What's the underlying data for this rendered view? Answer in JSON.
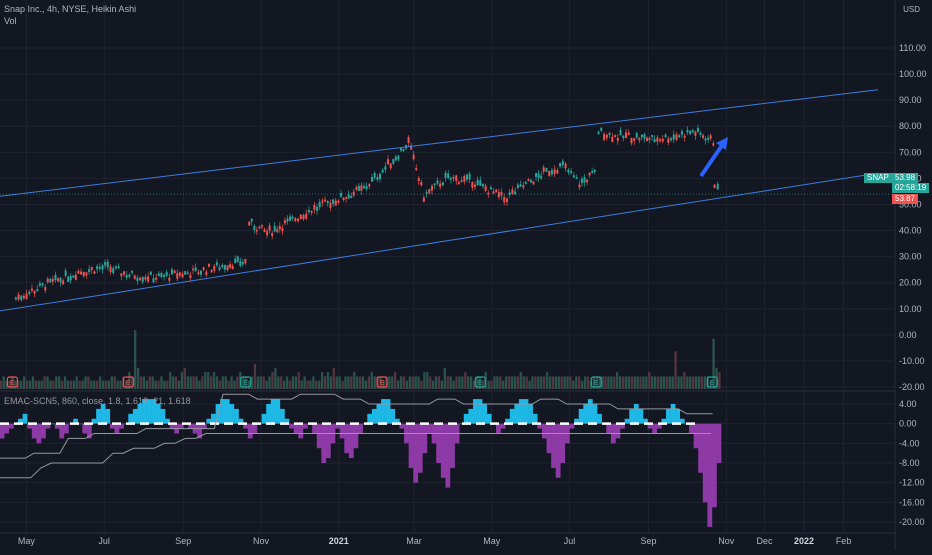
{
  "header": {
    "title": "Snap Inc., 4h, NYSE, Heikin Ashi",
    "volume_label": "Vol"
  },
  "currency": "USD",
  "ticker_badge": {
    "symbol": "SNAP",
    "last_price": "53.98",
    "countdown": "02:58:19",
    "low_price": "53.87"
  },
  "indicator_label": "EMAC-SCN5, 860, close, 1.8, 1.618, 21, 1.618",
  "colors": {
    "background": "#131722",
    "up": "#26a69a",
    "down": "#ef5350",
    "channel": "#2962ff",
    "hist_pos": "#1eb8e6",
    "hist_neg": "#8e3aa6",
    "event_red": "#ef5350",
    "event_green": "#26a69a"
  },
  "chart_data": [
    {
      "type": "line",
      "title": "Snap Inc., 4h, NYSE, Heikin Ashi",
      "x_ticks": [
        "May",
        "Jul",
        "Sep",
        "Nov",
        "2021",
        "Mar",
        "May",
        "Jul",
        "Sep",
        "Nov",
        "Dec",
        "2022",
        "Feb"
      ],
      "y_ticks": [
        "110.00",
        "100.00",
        "90.00",
        "80.00",
        "70.00",
        "60.00",
        "50.00",
        "40.00",
        "30.00",
        "20.00",
        "10.00",
        "0.00",
        "-10.00",
        "-20.00"
      ],
      "ylim": [
        -20,
        115
      ],
      "series": [
        {
          "name": "SNAP",
          "x": [
            "2020-04-22",
            "2020-05-15",
            "2020-06-10",
            "2020-07-01",
            "2020-07-20",
            "2020-08-10",
            "2020-09-10",
            "2020-10-05",
            "2020-10-19",
            "2020-10-22",
            "2020-11-05",
            "2020-11-25",
            "2020-12-10",
            "2020-12-31",
            "2021-01-20",
            "2021-02-10",
            "2021-02-24",
            "2021-03-08",
            "2021-03-25",
            "2021-04-15",
            "2021-05-10",
            "2021-05-25",
            "2021-06-10",
            "2021-06-25",
            "2021-07-08",
            "2021-07-20",
            "2021-07-23",
            "2021-08-05",
            "2021-08-20",
            "2021-09-05",
            "2021-09-20",
            "2021-10-05",
            "2021-10-15",
            "2021-10-21",
            "2021-10-22",
            "2021-10-27"
          ],
          "y": [
            14,
            19,
            24,
            26,
            23,
            22,
            24,
            27,
            28,
            43,
            39,
            44,
            48,
            52,
            56,
            66,
            74,
            53,
            60,
            59,
            52,
            57,
            62,
            65,
            58,
            62,
            78,
            76,
            76,
            75,
            76,
            78,
            76,
            74,
            58,
            53
          ],
          "color": "#ef5350"
        }
      ],
      "channel_lines": [
        {
          "name": "upper",
          "from": [
            "2020-04-08",
            53
          ],
          "to": [
            "2022-02-28",
            94
          ]
        },
        {
          "name": "lower",
          "from": [
            "2020-04-08",
            9
          ],
          "to": [
            "2022-02-28",
            62
          ]
        }
      ],
      "volume": {
        "values": [
          2,
          3,
          2,
          2,
          3,
          2,
          2,
          2,
          3,
          2,
          2,
          3,
          2,
          2,
          2,
          3,
          3,
          2,
          2,
          3,
          3,
          2,
          3,
          2,
          2,
          2,
          3,
          2,
          2,
          3,
          3,
          2,
          2,
          2,
          3,
          2,
          2,
          2,
          3,
          3,
          2,
          2,
          3,
          2,
          4,
          3,
          14,
          5,
          3,
          3,
          2,
          3,
          3,
          2,
          2,
          3,
          2,
          2,
          4,
          3,
          3,
          2,
          4,
          5,
          3,
          3,
          3,
          3,
          2,
          3,
          4,
          4,
          3,
          4,
          3,
          2,
          3,
          3,
          2,
          3,
          2,
          3,
          4,
          3,
          3,
          2,
          3,
          6,
          3,
          3,
          3,
          2,
          3,
          4,
          5,
          3,
          3,
          2,
          3,
          2,
          3,
          3,
          4,
          2,
          3,
          2,
          2,
          3,
          2,
          2,
          4,
          3,
          4,
          3,
          5,
          3,
          3,
          2,
          3,
          3,
          3,
          4,
          3,
          3,
          3,
          2,
          3,
          4,
          3,
          3,
          3,
          2,
          3,
          3,
          3,
          4,
          2,
          3,
          3,
          2,
          3,
          3,
          3,
          3,
          2,
          4,
          4,
          3,
          2,
          3,
          3,
          2,
          5,
          3,
          3,
          2,
          3,
          3,
          3,
          4,
          3,
          3,
          2,
          3,
          3,
          2,
          4,
          2,
          2,
          3,
          3,
          3,
          2,
          3,
          3,
          3,
          3,
          3,
          4,
          3,
          3,
          2,
          3,
          3,
          3,
          3,
          3,
          4,
          3,
          3,
          3,
          3,
          3,
          3,
          3,
          3,
          2,
          3,
          3,
          2,
          3,
          3,
          2,
          3,
          3,
          3,
          3,
          3,
          3,
          3,
          3,
          4,
          3,
          3,
          3,
          3,
          3,
          3,
          3,
          3,
          3,
          3,
          4,
          3,
          3,
          3,
          3,
          3,
          3,
          3,
          3,
          9,
          3,
          3,
          4,
          3,
          3,
          3,
          3,
          3,
          3,
          3,
          3,
          2,
          12,
          5,
          4
        ],
        "events": [
          {
            "x": "2020-04-20",
            "label": "E",
            "color": "#ef5350"
          },
          {
            "x": "2020-07-20",
            "label": "E",
            "color": "#ef5350"
          },
          {
            "x": "2020-10-20",
            "label": "E",
            "color": "#26a69a"
          },
          {
            "x": "2021-02-04",
            "label": "E",
            "color": "#ef5350"
          },
          {
            "x": "2021-04-22",
            "label": "E",
            "color": "#26a69a"
          },
          {
            "x": "2021-07-22",
            "label": "E",
            "color": "#26a69a"
          },
          {
            "x": "2021-10-21",
            "label": "E",
            "color": "#26a69a"
          }
        ]
      }
    },
    {
      "type": "area",
      "title": "EMAC-SCN5, 860, close, 1.8, 1.618, 21, 1.618",
      "y_ticks": [
        "4.00",
        "0.00",
        "-4.00",
        "-8.00",
        "-12.00",
        "-16.00",
        "-20.00"
      ],
      "ylim": [
        -22,
        6
      ],
      "series": [
        {
          "name": "oscillator",
          "values": [
            -3,
            -2,
            -1,
            0,
            1,
            2,
            -1,
            -3,
            -4,
            -3,
            -1,
            0,
            -1,
            -3,
            -2,
            0,
            1,
            0,
            -2,
            -3,
            1,
            3,
            4,
            3,
            -1,
            -2,
            -1,
            0,
            2,
            3,
            4,
            5,
            5,
            5,
            4,
            3,
            1,
            -1,
            -2,
            -1,
            0,
            -1,
            -2,
            -3,
            -1,
            1,
            2,
            4,
            5,
            5,
            4,
            3,
            1,
            -1,
            -3,
            -2,
            0,
            2,
            4,
            5,
            5,
            3,
            1,
            -1,
            -2,
            -3,
            -1,
            0,
            -2,
            -5,
            -8,
            -7,
            -4,
            -1,
            -3,
            -6,
            -7,
            -5,
            -2,
            0,
            2,
            3,
            4,
            5,
            5,
            3,
            1,
            -1,
            -4,
            -9,
            -12,
            -10,
            -6,
            -2,
            -4,
            -8,
            -11,
            -13,
            -9,
            -4,
            0,
            2,
            3,
            5,
            5,
            4,
            2,
            0,
            -2,
            -1,
            1,
            3,
            4,
            5,
            5,
            4,
            2,
            -1,
            -3,
            -6,
            -9,
            -11,
            -8,
            -4,
            -1,
            1,
            3,
            4,
            5,
            4,
            2,
            0,
            -2,
            -4,
            -3,
            -1,
            1,
            3,
            4,
            3,
            1,
            -1,
            -2,
            -1,
            1,
            3,
            4,
            3,
            1,
            0,
            -2,
            -5,
            -10,
            -16,
            -21,
            -17,
            -8
          ]
        },
        {
          "name": "upper band",
          "values": [
            -7,
            -7,
            -7,
            -7,
            -6,
            -6,
            -6,
            -6,
            -3,
            -3,
            -3,
            -2,
            -2,
            -2,
            -2,
            -2,
            -2,
            -1,
            -1,
            -1,
            -1,
            -1,
            -1,
            -1,
            -1,
            -1,
            6,
            6,
            6,
            6,
            5,
            5,
            5,
            5,
            5,
            6,
            6,
            6,
            6,
            6,
            5,
            5,
            5,
            4,
            4,
            4,
            4,
            4,
            4,
            4,
            4,
            5,
            5,
            5,
            4,
            4,
            4,
            4,
            4,
            4,
            4,
            4,
            4,
            5,
            5,
            5,
            4,
            4,
            4,
            4,
            4,
            4,
            3,
            3,
            3,
            3,
            3,
            3,
            3,
            3,
            2,
            2,
            2,
            2
          ]
        },
        {
          "name": "lower band",
          "values": [
            -11,
            -11,
            -11,
            -11,
            -9,
            -8,
            -8,
            -8,
            -8,
            -8,
            -8,
            -6,
            -6,
            -5,
            -5,
            -5,
            -4,
            -4,
            -3,
            -3,
            -2,
            -2,
            -2,
            -2,
            -2,
            -2,
            -2,
            -2,
            -2,
            -2,
            -2,
            -2,
            -2,
            -2,
            -2,
            -2,
            -2,
            -2,
            -2,
            -2,
            -2,
            -2,
            -2,
            -2,
            -2,
            -2,
            -2,
            -2,
            -2,
            -2,
            -2,
            -2,
            -2,
            -2,
            -2,
            -2,
            -2,
            -2,
            -2,
            -2,
            -2,
            -2,
            -2,
            -2,
            -2,
            -2,
            -2,
            -2,
            -2,
            -2
          ]
        }
      ]
    }
  ]
}
